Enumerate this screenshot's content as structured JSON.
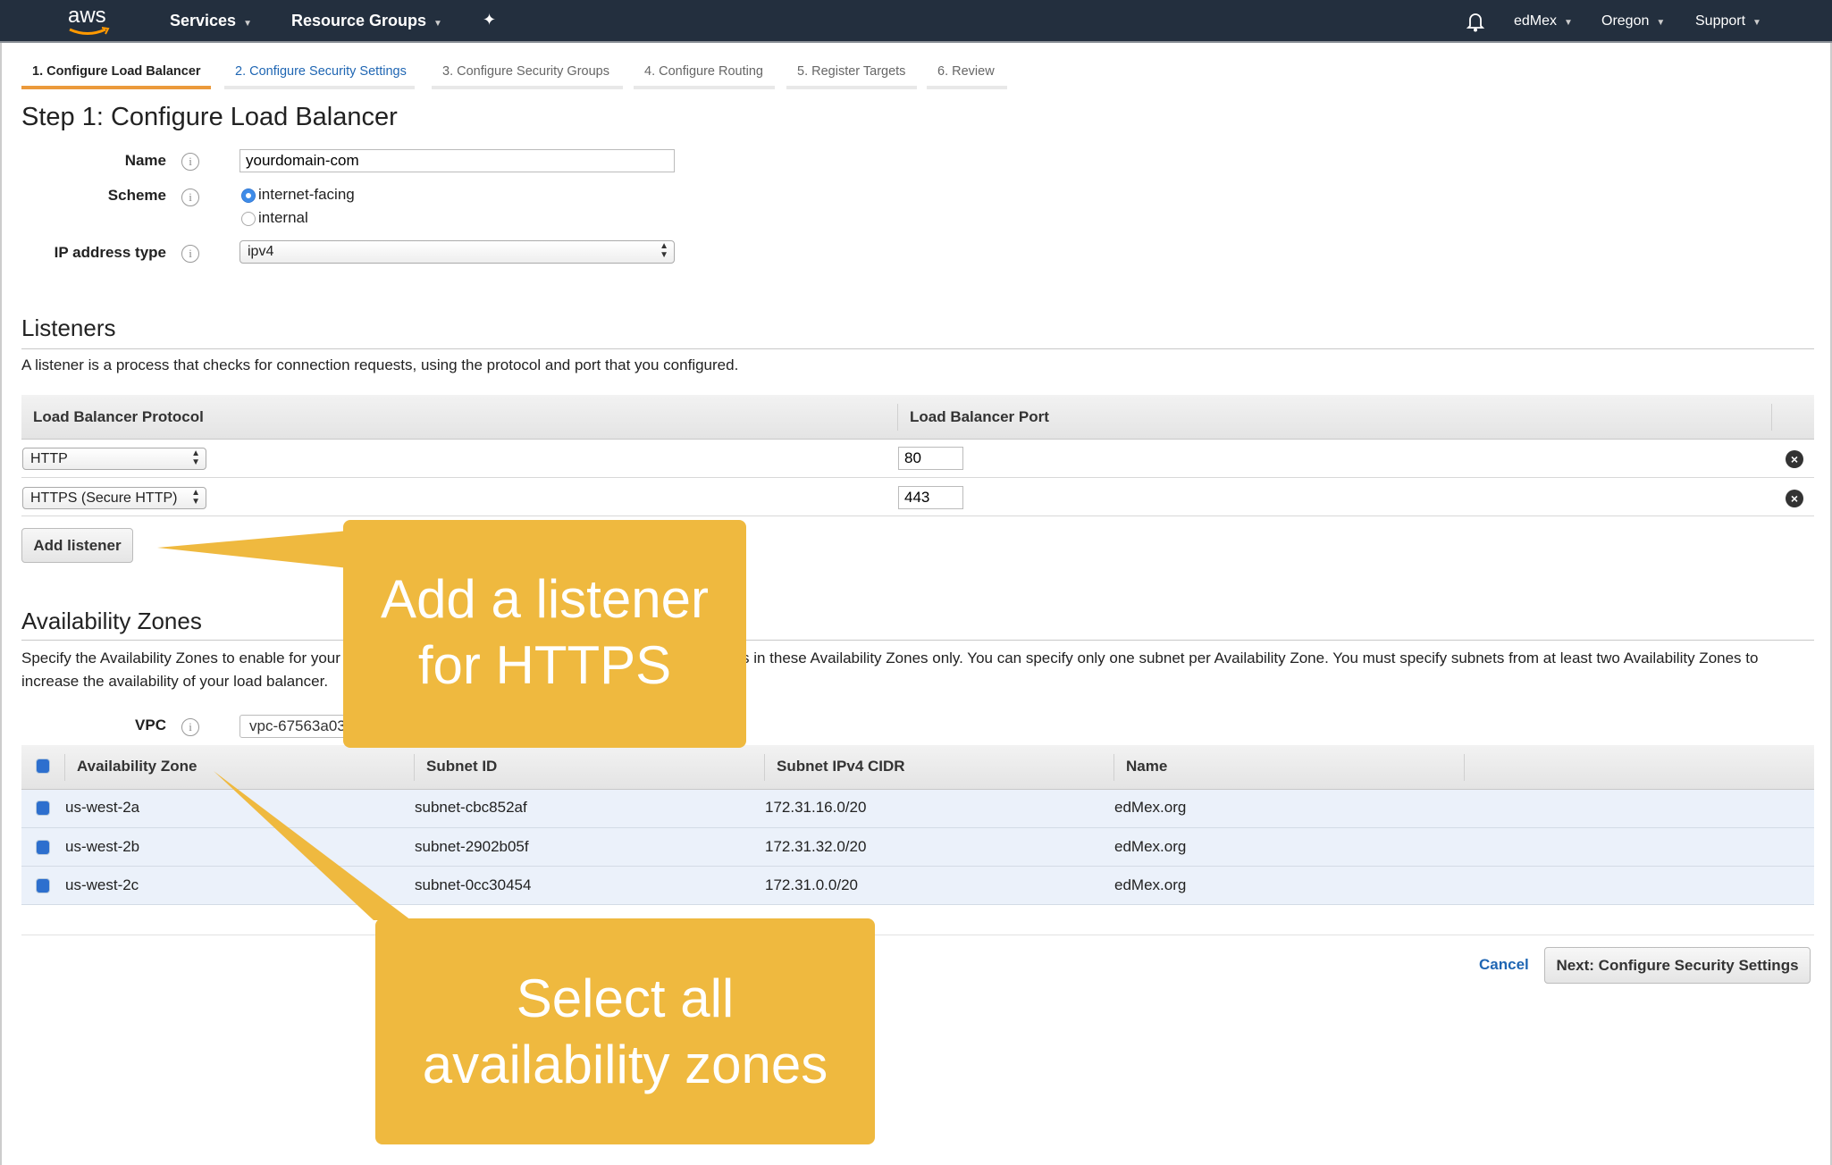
{
  "nav": {
    "logo": "aws",
    "services": "Services",
    "resource_groups": "Resource Groups",
    "pin_icon": "pin-icon",
    "bell_icon": "bell-icon",
    "account": "edMex",
    "region": "Oregon",
    "support": "Support"
  },
  "wizard_tabs": [
    {
      "label": "1. Configure Load Balancer"
    },
    {
      "label": "2. Configure Security Settings"
    },
    {
      "label": "3. Configure Security Groups"
    },
    {
      "label": "4. Configure Routing"
    },
    {
      "label": "5. Register Targets"
    },
    {
      "label": "6. Review"
    }
  ],
  "page_title": "Step 1: Configure Load Balancer",
  "form": {
    "name_label": "Name",
    "name_value": "yourdomain-com",
    "scheme_label": "Scheme",
    "scheme_options": [
      "internet-facing",
      "internal"
    ],
    "scheme_selected": "internet-facing",
    "ip_label": "IP address type",
    "ip_value": "ipv4",
    "info_glyph": "i"
  },
  "listeners": {
    "title": "Listeners",
    "description": "A listener is a process that checks for connection requests, using the protocol and port that you configured.",
    "columns": [
      "Load Balancer Protocol",
      "Load Balancer Port"
    ],
    "rows": [
      {
        "protocol": "HTTP",
        "port": "80"
      },
      {
        "protocol": "HTTPS (Secure HTTP)",
        "port": "443"
      }
    ],
    "add_button": "Add listener",
    "remove_glyph": "×"
  },
  "availability_zones": {
    "title": "Availability Zones",
    "description_line1_left": "Specify the Availability Zones to enable for your",
    "description_line1_right": "s in these Availability Zones only. You can specify only one subnet per Availability Zone. You must specify subnets from at least two Availability Zones to",
    "description_line2": "increase the availability of your load balancer.",
    "vpc_label": "VPC",
    "vpc_value": "vpc-67563a03",
    "columns": [
      "Availability Zone",
      "Subnet ID",
      "Subnet IPv4 CIDR",
      "Name"
    ],
    "rows": [
      {
        "zone": "us-west-2a",
        "subnet": "subnet-cbc852af",
        "cidr": "172.31.16.0/20",
        "name": "edMex.org",
        "checked": true
      },
      {
        "zone": "us-west-2b",
        "subnet": "subnet-2902b05f",
        "cidr": "172.31.32.0/20",
        "name": "edMex.org",
        "checked": true
      },
      {
        "zone": "us-west-2c",
        "subnet": "subnet-0cc30454",
        "cidr": "172.31.0.0/20",
        "name": "edMex.org",
        "checked": true
      }
    ]
  },
  "footer": {
    "cancel": "Cancel",
    "next": "Next: Configure Security Settings"
  },
  "callouts": {
    "listener_line1": "Add a listener",
    "listener_line2": "for HTTPS",
    "zones_line1": "Select all",
    "zones_line2": "availability zones",
    "color": "#efb93f"
  },
  "colors": {
    "nav_bg": "#232f3e",
    "active_tab": "#eb9a3c",
    "link": "#1f66b3",
    "checkbox": "#2d6fce"
  }
}
